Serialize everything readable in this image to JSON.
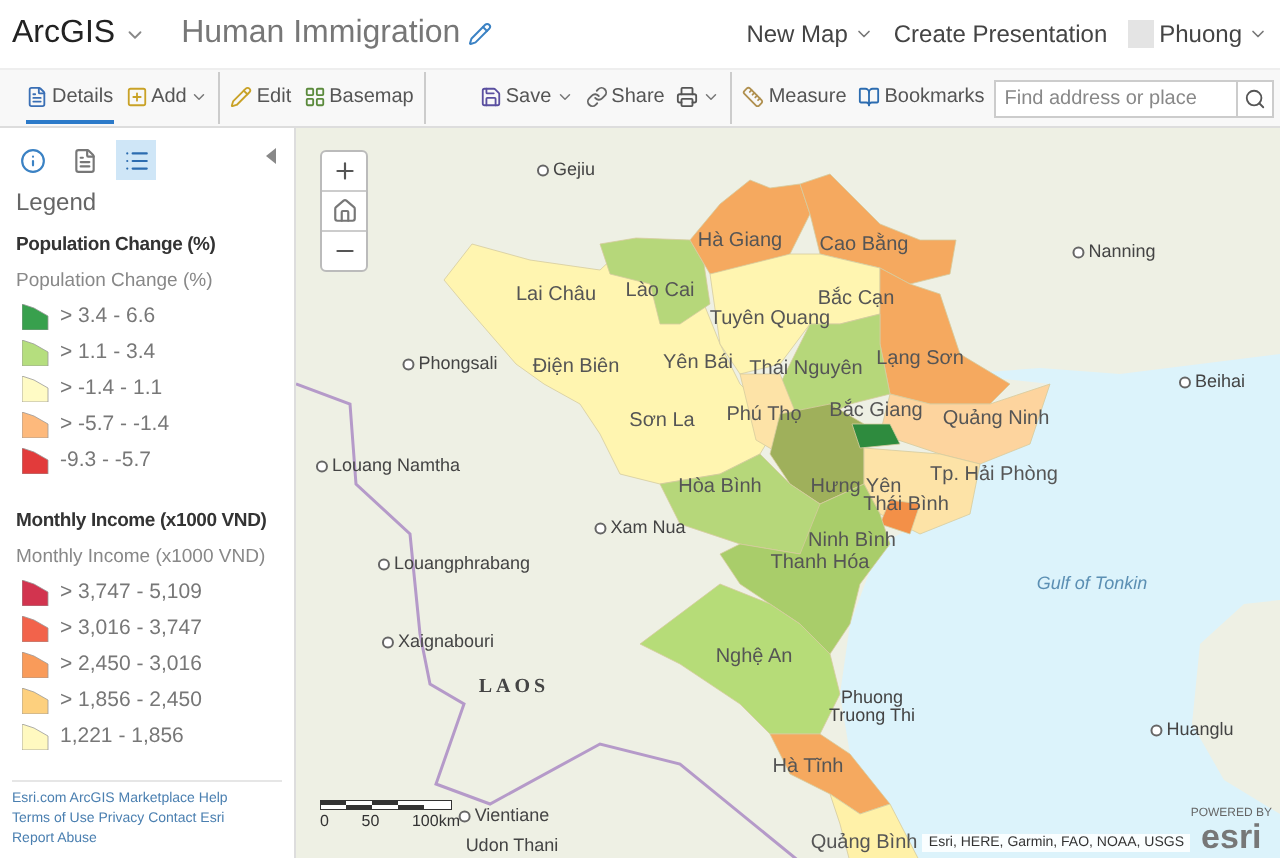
{
  "app": {
    "name": "ArcGIS",
    "map_title": "Human Immigration"
  },
  "header_menu": [
    {
      "label": "New Map",
      "dropdown": true
    },
    {
      "label": "Create Presentation",
      "dropdown": false
    }
  ],
  "user": {
    "name": "Phuong"
  },
  "toolbar": {
    "groups": [
      {
        "tools": [
          {
            "label": "Details",
            "dropdown": false,
            "selected": true
          },
          {
            "label": "Add",
            "dropdown": true,
            "selected": false
          }
        ]
      },
      {
        "tools": [
          {
            "label": "Edit",
            "dropdown": false,
            "selected": false
          },
          {
            "label": "Basemap",
            "dropdown": false,
            "selected": false
          }
        ]
      },
      {
        "tools": [
          {
            "label": "Save",
            "dropdown": true,
            "selected": false
          },
          {
            "label": "Share",
            "dropdown": false,
            "selected": false
          },
          {
            "dropdown": true,
            "selected": false
          }
        ]
      },
      {
        "tools": [
          {
            "label": "Measure",
            "dropdown": false,
            "selected": false
          },
          {
            "label": "Bookmarks",
            "dropdown": false,
            "selected": false
          }
        ]
      }
    ]
  },
  "search": {
    "placeholder": "Find address or place"
  },
  "panel": {
    "tabs": [
      {
        "selected": false
      },
      {
        "selected": false
      },
      {
        "selected": true
      }
    ],
    "title": "Legend",
    "layers": [
      {
        "title": "Population Change (%)",
        "field": "Population Change (%)",
        "classes": [
          {
            "label": "> 3.4 - 6.6",
            "color": "#38a04d"
          },
          {
            "label": "> 1.1 - 3.4",
            "color": "#b5de7e"
          },
          {
            "label": "> -1.4 - 1.1",
            "color": "#fffbc5"
          },
          {
            "label": "> -5.7 - -1.4",
            "color": "#fdb97c"
          },
          {
            "label": "-9.3 - -5.7",
            "color": "#e23b3b"
          }
        ]
      },
      {
        "title": "Monthly Income (x1000 VND)",
        "field": "Monthly Income (x1000 VND)",
        "classes": [
          {
            "label": "> 3,747 - 5,109",
            "color": "#d2344f"
          },
          {
            "label": "> 3,016 - 3,747",
            "color": "#f2634b"
          },
          {
            "label": "> 2,450 - 3,016",
            "color": "#f99b5a"
          },
          {
            "label": "> 1,856 - 2,450",
            "color": "#fdd07e"
          },
          {
            "label": "1,221 - 1,856",
            "color": "#fff9c0"
          }
        ]
      }
    ],
    "footer_links": [
      "Esri.com",
      "ArcGIS Marketplace",
      "Help",
      "Terms of Use",
      "Privacy",
      "Contact Esri",
      "Report Abuse"
    ]
  },
  "map": {
    "labels": [
      {
        "text": "Gejiu",
        "kind": "city"
      },
      {
        "text": "Hà Giang",
        "kind": "province"
      },
      {
        "text": "Cao Bằng",
        "kind": "province"
      },
      {
        "text": "Nanning",
        "kind": "city"
      },
      {
        "text": "Lai Châu",
        "kind": "province"
      },
      {
        "text": "Lào Cai",
        "kind": "province"
      },
      {
        "text": "Bắc Cạn",
        "kind": "province"
      },
      {
        "text": "Tuyên Quang",
        "kind": "province"
      },
      {
        "text": "Phongsali",
        "kind": "city"
      },
      {
        "text": "Điện Biên",
        "kind": "province"
      },
      {
        "text": "Yên Bái",
        "kind": "province"
      },
      {
        "text": "Thái Nguyên",
        "kind": "province"
      },
      {
        "text": "Lạng Sơn",
        "kind": "province"
      },
      {
        "text": "Beihai",
        "kind": "city"
      },
      {
        "text": "Sơn La",
        "kind": "province"
      },
      {
        "text": "Phú Thọ",
        "kind": "province"
      },
      {
        "text": "Bắc Giang",
        "kind": "province"
      },
      {
        "text": "Quảng Ninh",
        "kind": "province"
      },
      {
        "text": "Louang Namtha",
        "kind": "city"
      },
      {
        "text": "Tp. Hải Phòng",
        "kind": "province"
      },
      {
        "text": "Hòa Bình",
        "kind": "province"
      },
      {
        "text": "Hưng Yên",
        "kind": "province"
      },
      {
        "text": "Thái Bình",
        "kind": "province"
      },
      {
        "text": "Xam Nua",
        "kind": "city"
      },
      {
        "text": "Ninh Bình",
        "kind": "province"
      },
      {
        "text": "Louangphrabang",
        "kind": "city"
      },
      {
        "text": "Thanh Hóa",
        "kind": "province"
      },
      {
        "text": "Gulf of Tonkin",
        "kind": "water"
      },
      {
        "text": "Xaignabouri",
        "kind": "city"
      },
      {
        "text": "Nghệ An",
        "kind": "province"
      },
      {
        "text": "LAOS",
        "kind": "country"
      },
      {
        "text": "Phuong Truong Thi",
        "kind": "town"
      },
      {
        "text": "Huanglu",
        "kind": "city"
      },
      {
        "text": "Hà Tĩnh",
        "kind": "province"
      },
      {
        "text": "Vientiane",
        "kind": "city"
      },
      {
        "text": "Udon Thani",
        "kind": "town"
      },
      {
        "text": "Quảng Bình",
        "kind": "province"
      }
    ],
    "scale_bar": {
      "ticks": [
        "0",
        "50",
        "100km"
      ]
    },
    "attribution": "Esri, HERE, Garmin, FAO, NOAA, USGS",
    "logo": {
      "caption": "POWERED BY",
      "name": "esri"
    }
  }
}
